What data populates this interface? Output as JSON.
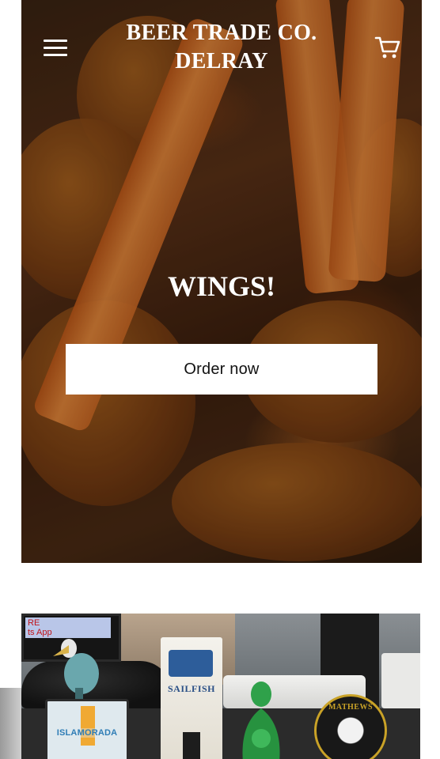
{
  "header": {
    "brand_line1": "BEER TRADE CO.",
    "brand_line2": "DELRAY",
    "menu_icon": "hamburger-menu-icon",
    "cart_icon": "shopping-cart-icon"
  },
  "hero": {
    "title": "WINGS!",
    "button_label": "Order now",
    "image_subject": "chicken wings with carrot sticks"
  },
  "photo2": {
    "tv_text_line1": "RE",
    "tv_text_line2": "ts App",
    "tap_labels": {
      "islamorada": "ISLAMORADA",
      "sailfish": "SAILFISH",
      "mathews": "MATHEWS"
    }
  },
  "colors": {
    "text_on_hero": "#ffffff",
    "button_background": "#ffffff",
    "button_text": "#111111",
    "page_background": "#ffffff"
  }
}
